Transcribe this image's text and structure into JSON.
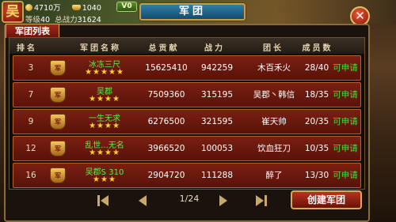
{
  "hud": {
    "avatar_char": "吴",
    "gold": "4710万",
    "ingots": "1040",
    "level_label": "等级",
    "level": "40",
    "power_label": "总战力",
    "power": "31624",
    "vip": "V0"
  },
  "window": {
    "title": "军团",
    "tab": "军团列表"
  },
  "columns": {
    "rank": "排名",
    "name": "军团名称",
    "contribution": "总贡献",
    "power": "战力",
    "leader": "团长",
    "members": "成员数"
  },
  "rows": [
    {
      "rank": "3",
      "name": "冰冻三尺",
      "stars": "★★★★★",
      "contribution": "15625410",
      "power": "942259",
      "leader": "木百禾火",
      "members": "28/40",
      "action": "可申请"
    },
    {
      "rank": "7",
      "name": "吴郡",
      "stars": "★★★★",
      "contribution": "7509360",
      "power": "315195",
      "leader": "吴郡丶韩信",
      "members": "18/35",
      "action": "可申请"
    },
    {
      "rank": "9",
      "name": "一生无求",
      "stars": "★★★★",
      "contribution": "6276500",
      "power": "321595",
      "leader": "崔天帅",
      "members": "20/35",
      "action": "可申请"
    },
    {
      "rank": "12",
      "name": "乱世...无名",
      "stars": "★★★★",
      "contribution": "3966520",
      "power": "100053",
      "leader": "饮血狂刀",
      "members": "10/35",
      "action": "可申请"
    },
    {
      "rank": "16",
      "name": "吴郡S 310",
      "stars": "★★★",
      "contribution": "2904720",
      "power": "111288",
      "leader": "醉了",
      "members": "13/30",
      "action": "可申请"
    }
  ],
  "pager": {
    "page": "1/24"
  },
  "create_button": "创建军团",
  "colors": {
    "accent_green": "#3ee03a",
    "row_red": "#7a1f12",
    "gold": "#ffd12a"
  }
}
